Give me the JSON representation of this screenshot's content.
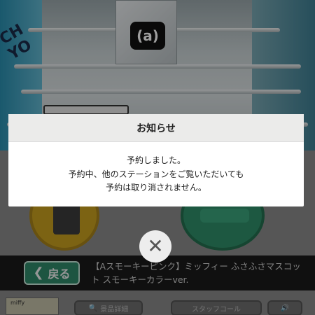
{
  "modal": {
    "title": "お知らせ",
    "lines": [
      "予約しました。",
      "予約中、他のステーションをご覧いただいても",
      "予約は取り消されません。"
    ],
    "close_icon": "close-icon",
    "close_glyph": "✕"
  },
  "camera": {
    "wall_text": "CH YO",
    "claw_logo": "(a)"
  },
  "bottom_bar": {
    "back_label": "戻る",
    "back_chevron": "❮",
    "prize_title": "【Aスモーキーピンク】ミッフィー ふさふさマスコット スモーキーカラーver."
  },
  "footer": {
    "thumb_label": "miffy",
    "buttons": [
      {
        "label": "景品詳細",
        "icon": "search-icon",
        "glyph": "🔍"
      },
      {
        "label": "スタッフコール",
        "icon": "staff-call-icon",
        "glyph": ""
      },
      {
        "label": "",
        "icon": "speaker-icon",
        "glyph": "🔊"
      }
    ]
  },
  "colors": {
    "back_button": "#2f8a6a",
    "modal_header": "#ebebea",
    "yellow_button": "#c9a11f",
    "green_button": "#2f8f6a"
  }
}
